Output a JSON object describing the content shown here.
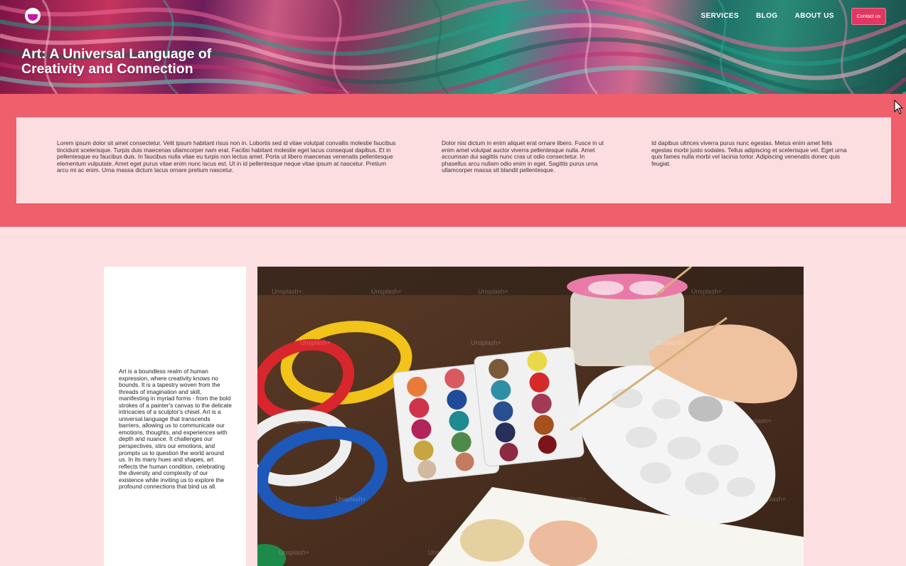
{
  "header": {
    "title": "Art: A Universal Language of Creativity and Connection",
    "nav": [
      "SERVICES",
      "BLOG",
      "ABOUT US"
    ],
    "contact_label": "Contact us",
    "logo_icon": "logo-icon"
  },
  "band": {
    "col1": "Lorem ipsum dolor sit amet consectetur. Velit ipsum habitant risus non in. Lobortis sed id vitae volutpat convallis molestie faucibus tincidunt scelerisque. Turpis duis maecenas ullamcorper nam erat. Facilisi habitant molestie eget lacus consequat dapibus. Et in pellentesque eu faucibus duis. In faucibus nulla vitae eu turpis non lectus amet. Porta ut libero maecenas venenatis pellentesque elementum vulputate. Amet eget purus vitae enim nunc lacus est. Ut in id pellentesque neque vitae ipsum at nascetur. Pretium arcu mi ac enim. Urna massa dictum lacus ornare pretium nascetur.",
    "col2": "Dolor nisi dictum in enim aliquet erat ornare libero. Fusce in ut enim amet volutpat auctor viverra pellentesque nulla. Amet accumsan dui sagittis nunc cras ut odio consectetur. In phasellus arcu nullam odio enim in eget. Sagittis purus urna ullamcorper massa sit blandit pellentesque.",
    "col3": "Id dapibus ultrices viverra purus nunc egestas. Metus enim amet felis egestas morbi justo sodales. Tellus adipiscing et scelerisque vel. Eget urna quis fames nulla morbi vel lacinia tortor. Adipiscing venenatis donec quis feugiat."
  },
  "main": {
    "side_text": "Art is a boundless realm of human expression, where creativity knows no bounds. It is a tapestry woven from the threads of imagination and skill, manifesting in myriad forms - from the bold strokes of a painter's canvas to the delicate intricacies of a sculptor's chisel. Art is a universal language that transcends barriers, allowing us to communicate our emotions, thoughts, and experiences with depth and nuance. It challenges our perspectives, stirs our emotions, and prompts us to question the world around us. In its many hues and shapes, art reflects the human condition, celebrating the diversity and complexity of our existence while inviting us to explore the profound connections that bind us all.",
    "photo_watermark": "Unsplash+"
  },
  "colors": {
    "band": "#ef5f6c",
    "card": "#fcdde0",
    "page": "#fce0e2",
    "accent": "#e03763"
  }
}
